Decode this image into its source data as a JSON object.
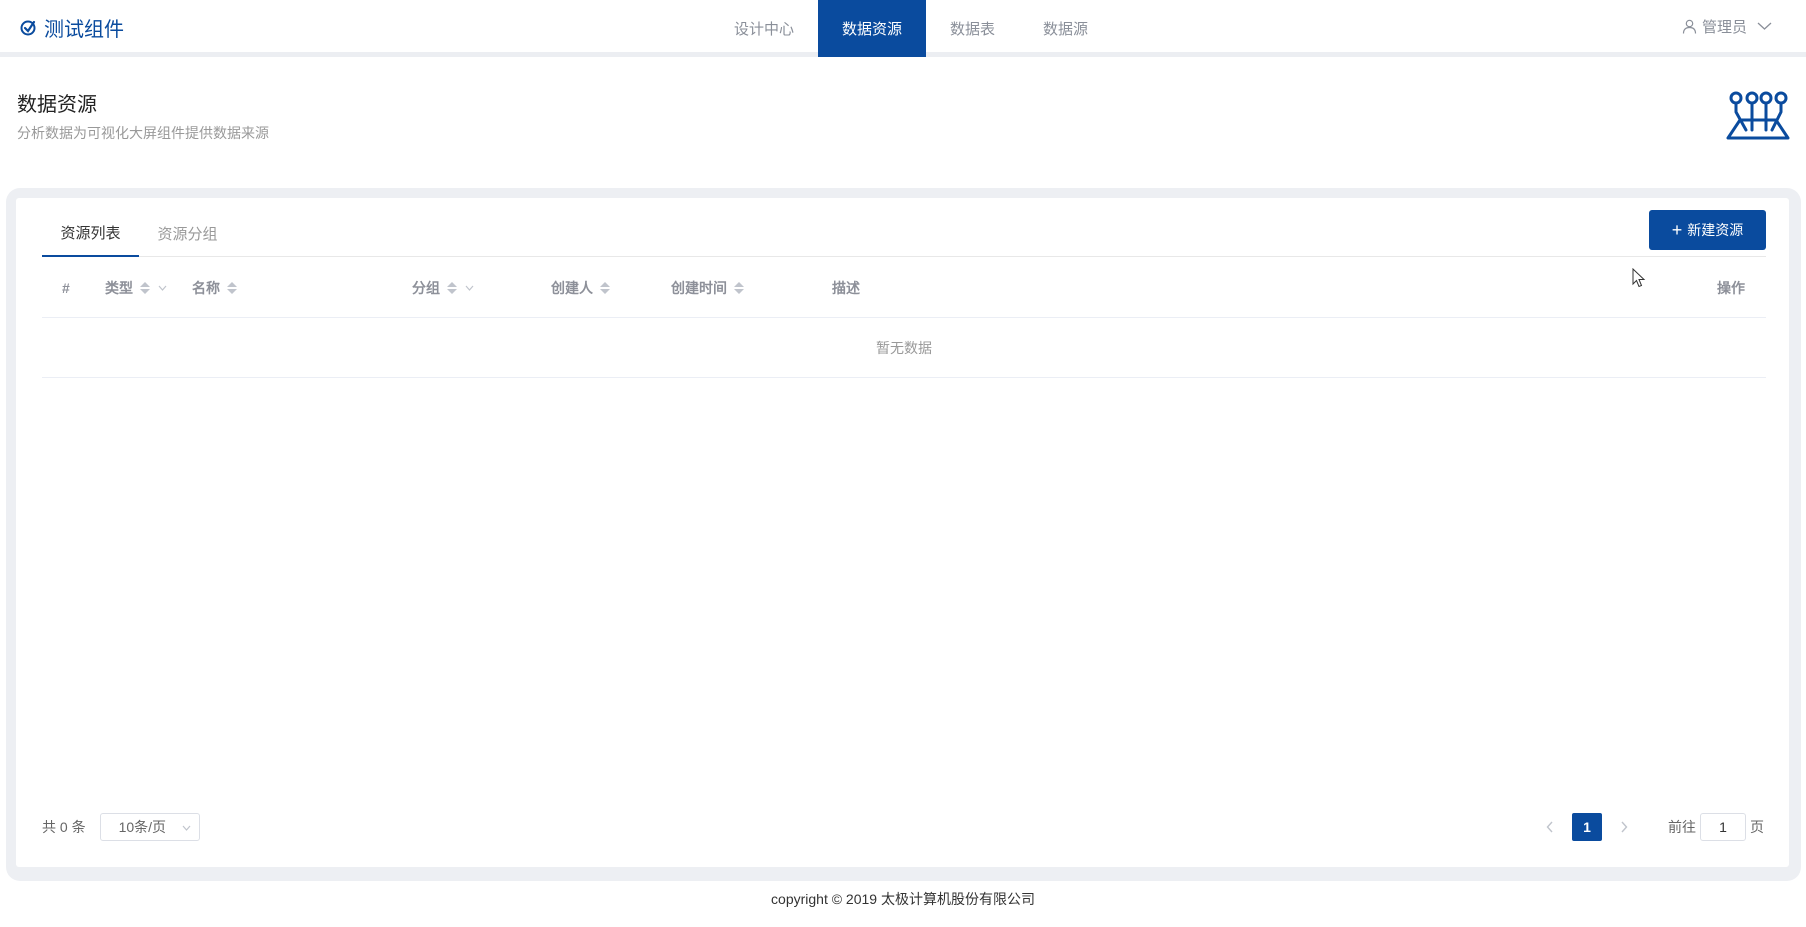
{
  "app": {
    "title": "测试组件"
  },
  "nav": [
    {
      "label": "设计中心",
      "active": false
    },
    {
      "label": "数据资源",
      "active": true
    },
    {
      "label": "数据表",
      "active": false
    },
    {
      "label": "数据源",
      "active": false
    }
  ],
  "user": {
    "name": "管理员"
  },
  "page": {
    "title": "数据资源",
    "subtitle": "分析数据为可视化大屏组件提供数据来源"
  },
  "tabs": [
    {
      "label": "资源列表",
      "active": true
    },
    {
      "label": "资源分组",
      "active": false
    }
  ],
  "actions": {
    "new_label": "新建资源"
  },
  "table": {
    "columns": {
      "index": "#",
      "type": "类型",
      "name": "名称",
      "group": "分组",
      "creator": "创建人",
      "created_at": "创建时间",
      "description": "描述",
      "actions": "操作"
    },
    "empty_text": "暂无数据"
  },
  "pagination": {
    "total_text": "共 0 条",
    "page_size": "10条/页",
    "current_page": "1",
    "goto_prefix": "前往",
    "goto_value": "1",
    "goto_suffix": "页"
  },
  "footer": {
    "text": "copyright © 2019 太极计算机股份有限公司"
  },
  "colors": {
    "primary": "#0a4b9e",
    "muted": "#999999",
    "background": "#edeff3"
  }
}
